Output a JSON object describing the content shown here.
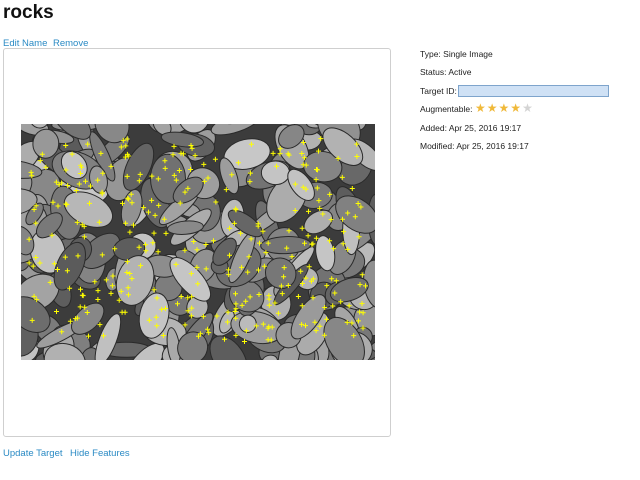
{
  "page": {
    "title": "rocks"
  },
  "actions": {
    "edit_name": "Edit Name",
    "remove": "Remove",
    "update_target": "Update Target",
    "hide_features": "Hide Features"
  },
  "details": {
    "type": "Type: Single Image",
    "status": "Status: Active",
    "target_id_label": "Target ID:",
    "target_id_value": "",
    "augmentable_label": "Augmentable:",
    "augmentable_rating": 4,
    "augmentable_max": 5,
    "added": "Added: Apr 25, 2016 19:17",
    "modified": "Modified: Apr 25, 2016 19:17"
  },
  "colors": {
    "link": "#2a8ac4",
    "star_on": "#f0b93a",
    "star_off": "#d4d4d4",
    "feature_marker": "#ffff00",
    "input_bg": "#cfe1f5"
  },
  "icons": {
    "rating": "star-icon",
    "feature": "plus-marker-icon"
  }
}
